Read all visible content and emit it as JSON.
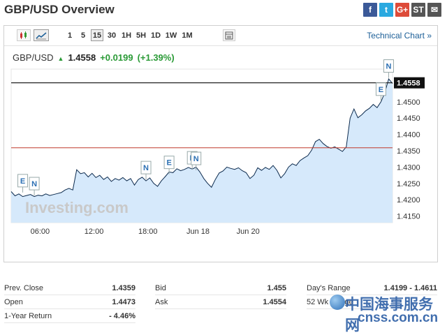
{
  "header": {
    "title": "GBP/USD Overview"
  },
  "social": [
    {
      "name": "facebook-icon",
      "glyph": "f",
      "color": "#3b5998"
    },
    {
      "name": "twitter-icon",
      "glyph": "t",
      "color": "#2aa9e0"
    },
    {
      "name": "google-plus-icon",
      "glyph": "G+",
      "color": "#dd4b39"
    },
    {
      "name": "stocktwits-icon",
      "glyph": "ST",
      "color": "#555555"
    },
    {
      "name": "email-icon",
      "glyph": "✉",
      "color": "#555555"
    }
  ],
  "toolbar": {
    "timeframes": [
      "1",
      "5",
      "15",
      "30",
      "1H",
      "5H",
      "1D",
      "1W",
      "1M"
    ],
    "active": "15",
    "technical_chart": "Technical Chart »"
  },
  "quote": {
    "symbol": "GBP/USD",
    "arrow": "▲",
    "price": "1.4558",
    "change": "+0.0199",
    "change_pct": "(+1.39%)"
  },
  "watermark": "Investing.com",
  "chart_data": {
    "type": "area",
    "x_ticks": [
      "06:00",
      "12:00",
      "18:00",
      "Jun 18",
      "Jun 20"
    ],
    "y_ticks": [
      "1.4150",
      "1.4200",
      "1.4250",
      "1.4300",
      "1.4350",
      "1.4400",
      "1.4450",
      "1.4500"
    ],
    "ylim": [
      1.413,
      1.46
    ],
    "current_price_label": "1.4558",
    "current_price": 1.4558,
    "prev_close": 1.4359,
    "x": [
      0,
      1,
      2,
      3,
      4,
      5,
      6,
      7,
      8,
      9,
      10,
      11,
      12,
      13,
      14,
      15,
      16,
      17,
      18,
      19,
      20,
      21,
      22,
      23,
      24,
      25,
      26,
      27,
      28,
      29,
      30,
      31,
      32,
      33,
      34,
      35,
      36,
      37,
      38,
      39,
      40,
      41,
      42,
      43,
      44,
      45,
      46,
      47,
      48,
      49,
      50,
      51,
      52,
      53,
      54,
      55,
      56,
      57,
      58,
      59,
      60,
      61,
      62,
      63,
      64,
      65,
      66,
      67,
      68,
      69,
      70,
      71,
      72,
      73,
      74,
      75,
      76,
      77,
      78,
      79,
      80,
      81,
      82,
      83,
      84,
      85,
      86,
      87,
      88,
      89,
      90,
      91,
      92,
      93,
      94,
      95,
      96,
      97,
      98,
      99
    ],
    "values": [
      1.4225,
      1.4212,
      1.4218,
      1.421,
      1.4213,
      1.4216,
      1.421,
      1.4214,
      1.4212,
      1.4218,
      1.4213,
      1.4216,
      1.4219,
      1.4222,
      1.423,
      1.4235,
      1.423,
      1.4292,
      1.428,
      1.4283,
      1.427,
      1.4281,
      1.4268,
      1.4275,
      1.4262,
      1.427,
      1.4256,
      1.4265,
      1.426,
      1.4268,
      1.4258,
      1.4265,
      1.4245,
      1.4262,
      1.4269,
      1.4258,
      1.4267,
      1.425,
      1.4241,
      1.4258,
      1.4271,
      1.4285,
      1.4283,
      1.4295,
      1.4289,
      1.4293,
      1.4299,
      1.4294,
      1.43,
      1.4285,
      1.4265,
      1.425,
      1.4238,
      1.4262,
      1.4282,
      1.4288,
      1.43,
      1.4296,
      1.4293,
      1.4298,
      1.4289,
      1.4283,
      1.4265,
      1.4275,
      1.4298,
      1.429,
      1.4299,
      1.4293,
      1.4305,
      1.429,
      1.4267,
      1.428,
      1.43,
      1.431,
      1.4305,
      1.432,
      1.4328,
      1.4335,
      1.4352,
      1.4378,
      1.4385,
      1.4372,
      1.4363,
      1.4358,
      1.4362,
      1.4355,
      1.4348,
      1.4362,
      1.445,
      1.4478,
      1.4451,
      1.446,
      1.4472,
      1.448,
      1.4492,
      1.4482,
      1.45,
      1.4528,
      1.457,
      1.4556
    ],
    "events": [
      {
        "label": "E",
        "x": 3,
        "y": 1.4235
      },
      {
        "label": "N",
        "x": 6,
        "y": 1.4226
      },
      {
        "label": "N",
        "x": 35,
        "y": 1.4275
      },
      {
        "label": "E",
        "x": 41,
        "y": 1.4291
      },
      {
        "label": "E",
        "x": 47,
        "y": 1.4305
      },
      {
        "label": "N",
        "x": 48,
        "y": 1.4303
      },
      {
        "label": "E",
        "x": 96,
        "y": 1.4515
      },
      {
        "label": "N",
        "x": 98,
        "y": 1.4586
      }
    ],
    "x_tick_positions": [
      7.5,
      21.5,
      35.5,
      48.5,
      61.5
    ]
  },
  "stats": {
    "prev_close_label": "Prev. Close",
    "prev_close": "1.4359",
    "open_label": "Open",
    "open": "1.4473",
    "year_return_label": "1-Year Return",
    "year_return": "- 4.46%",
    "bid_label": "Bid",
    "bid": "1.455",
    "ask_label": "Ask",
    "ask": "1.4554",
    "days_range_label": "Day's Range",
    "days_range": "1.4199 - 1.4611",
    "week52_label": "52 Wk Range"
  },
  "site_watermark": {
    "cn": "中国海事服务网",
    "url": "cnss.com.cn"
  }
}
